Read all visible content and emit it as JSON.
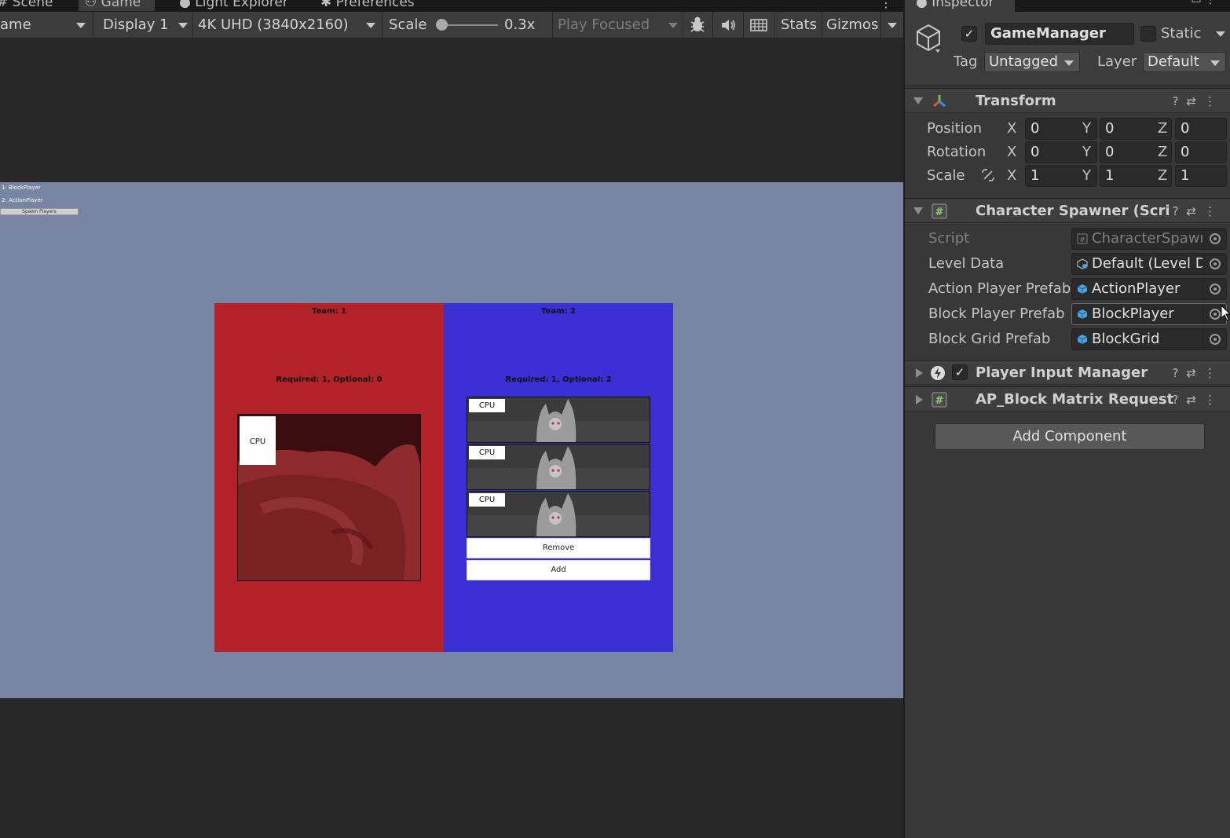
{
  "tabs": {
    "scene": "Scene",
    "game": "Game",
    "light_explorer": "Light Explorer",
    "preferences": "Preferences",
    "more": "⋮"
  },
  "toolbar": {
    "game_dropdown": "ame",
    "display": "Display 1",
    "resolution": "4K UHD (3840x2160)",
    "scale_label": "Scale",
    "scale_value": "0.3x",
    "play_mode": "Play Focused",
    "stats": "Stats",
    "gizmos": "Gizmos"
  },
  "game": {
    "debug": {
      "line1": "1: BlockPlayer",
      "line2": "2: ActionPlayer",
      "spawn_button": "Spawn Players"
    },
    "teams": [
      {
        "title": "Team: 1",
        "requirement": "Required: 1, Optional: 0",
        "color": "#b22228",
        "slots": [
          {
            "label": "CPU"
          }
        ]
      },
      {
        "title": "Team: 2",
        "requirement": "Required: 1, Optional: 2",
        "color": "#3a2fd4",
        "slots": [
          {
            "label": "CPU"
          },
          {
            "label": "CPU"
          },
          {
            "label": "CPU"
          }
        ],
        "remove_button": "Remove",
        "add_button": "Add"
      }
    ],
    "viewport_bg": "#7784a2"
  },
  "inspector": {
    "tab": "Inspector",
    "object_name": "GameManager",
    "static_label": "Static",
    "tag_label": "Tag",
    "tag_value": "Untagged",
    "layer_label": "Layer",
    "layer_value": "Default",
    "transform": {
      "title": "Transform",
      "position": {
        "label": "Position",
        "x": "0",
        "y": "0",
        "z": "0"
      },
      "rotation": {
        "label": "Rotation",
        "x": "0",
        "y": "0",
        "z": "0"
      },
      "scale": {
        "label": "Scale",
        "x": "1",
        "y": "1",
        "z": "1"
      },
      "axis_x": "X",
      "axis_y": "Y",
      "axis_z": "Z"
    },
    "character_spawner": {
      "title": "Character Spawner (Scri",
      "script_label": "Script",
      "script_value": "CharacterSpawne",
      "level_data_label": "Level Data",
      "level_data_value": "Default (Level Da",
      "action_prefab_label": "Action Player Prefab",
      "action_prefab_value": "ActionPlayer",
      "block_prefab_label": "Block Player Prefab",
      "block_prefab_value": "BlockPlayer",
      "grid_prefab_label": "Block Grid Prefab",
      "grid_prefab_value": "BlockGrid"
    },
    "player_input_manager": {
      "title": "Player Input Manager"
    },
    "block_matrix": {
      "title": "AP_Block Matrix Request"
    },
    "add_component": "Add Component"
  }
}
